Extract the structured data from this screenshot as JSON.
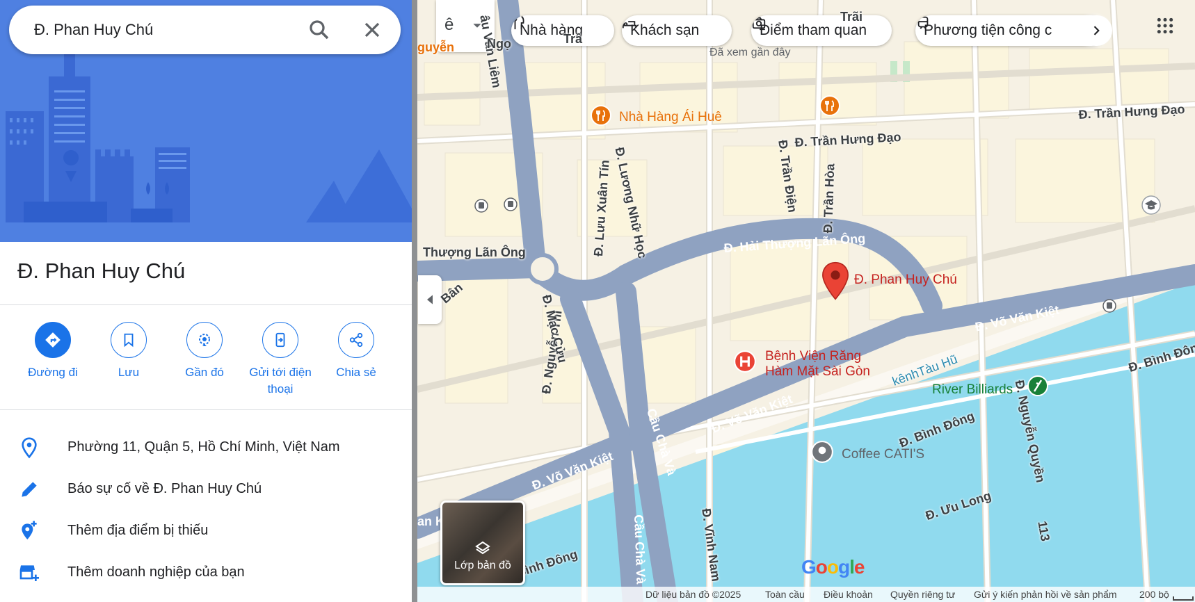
{
  "search": {
    "query": "Đ. Phan Huy Chú"
  },
  "place": {
    "title": "Đ. Phan Huy Chú"
  },
  "actions": [
    {
      "label": "Đường đi",
      "icon": "directions-icon"
    },
    {
      "label": "Lưu",
      "icon": "bookmark-icon"
    },
    {
      "label": "Gần đó",
      "icon": "nearby-icon"
    },
    {
      "label_line1": "Gửi tới điện",
      "label_line2": "thoại",
      "icon": "send-to-phone-icon"
    },
    {
      "label": "Chia sẻ",
      "icon": "share-icon"
    }
  ],
  "info_rows": [
    {
      "text": "Phường 11, Quận 5, Hồ Chí Minh, Việt Nam",
      "icon": "location-pin-icon"
    },
    {
      "text": "Báo sự cố về Đ. Phan Huy Chú",
      "icon": "edit-pencil-icon"
    },
    {
      "text": "Thêm địa điểm bị thiếu",
      "icon": "add-place-icon"
    },
    {
      "text": "Thêm doanh nghiệp của bạn",
      "icon": "add-business-icon"
    }
  ],
  "map": {
    "chips": [
      {
        "label": "Nhà hàng",
        "icon": "restaurant-icon"
      },
      {
        "label": "Khách sạn",
        "icon": "hotel-icon"
      },
      {
        "label": "Điểm tham quan",
        "icon": "camera-icon"
      },
      {
        "label": "Phương tiện công c",
        "icon": "transit-icon"
      }
    ],
    "input_tool_label": "ê",
    "recent_label": "Đã xem gần đây",
    "layer_label": "Lớp bản đồ",
    "pins": [
      {
        "label": "Nhà Hàng Ái Huê",
        "color": "#e8710a",
        "icon": "restaurant-icon"
      },
      {
        "label": "Đ. Phan Huy Chú",
        "color": "#ea4335",
        "icon": "location-pin-icon"
      },
      {
        "label_line1": "Bệnh Viện Răng",
        "label_line2": "Hàm Mặt Sài Gòn",
        "color": "#ea4335",
        "icon": "hospital-icon"
      },
      {
        "label": "River Billiards",
        "color": "#188038",
        "icon": "billiards-icon"
      },
      {
        "label": "Coffee CATI'S",
        "color": "#70757a",
        "icon": "place-icon"
      }
    ],
    "roads": [
      "Đ. Trần Hưng Đạo",
      "Đ. Trần Hưng Đạo",
      "Đ. Hải Thượng Lãn Ông",
      "Thượng Lãn Ông",
      "Đ. Võ Văn Kiệt",
      "Đ. Võ Văn Kiệt",
      "Đ. Võ Văn Kiệt",
      "Đ. Bình Đông",
      "Đ. Bình Đôn",
      "Bình Đông",
      "Đ. Ưu Long",
      "Cầu Chà Và",
      "Cầu Chà Và",
      "Đ. Nguyễn Thi",
      "Đ. Mạc Cửu",
      "Đ. Lưu Xuân Tín",
      "Đ. Lương Nhữ Học",
      "Đ. Trần Điện",
      "Đ. Trần Hòa",
      "Đ. Vĩnh Nam",
      "Đ. Nguyễn Quyền",
      "113",
      "kênhTàu Hũ",
      "Hũ",
      "Bân",
      "âu Văn Liêm",
      "Trãi",
      "guyễn",
      "an K",
      "Ngọ",
      "Trầ"
    ],
    "footer": [
      "Dữ liệu bản đồ ©2025",
      "Toàn cầu",
      "Điều khoản",
      "Quyền riêng tư",
      "Gửi ý kiến phản hồi về sản phẩm",
      "200 bộ"
    ],
    "logo": "Google"
  },
  "colors": {
    "accent": "#1a73e8",
    "pin_red": "#ea4335",
    "water": "#90daee",
    "road": "#8fa2c1"
  }
}
